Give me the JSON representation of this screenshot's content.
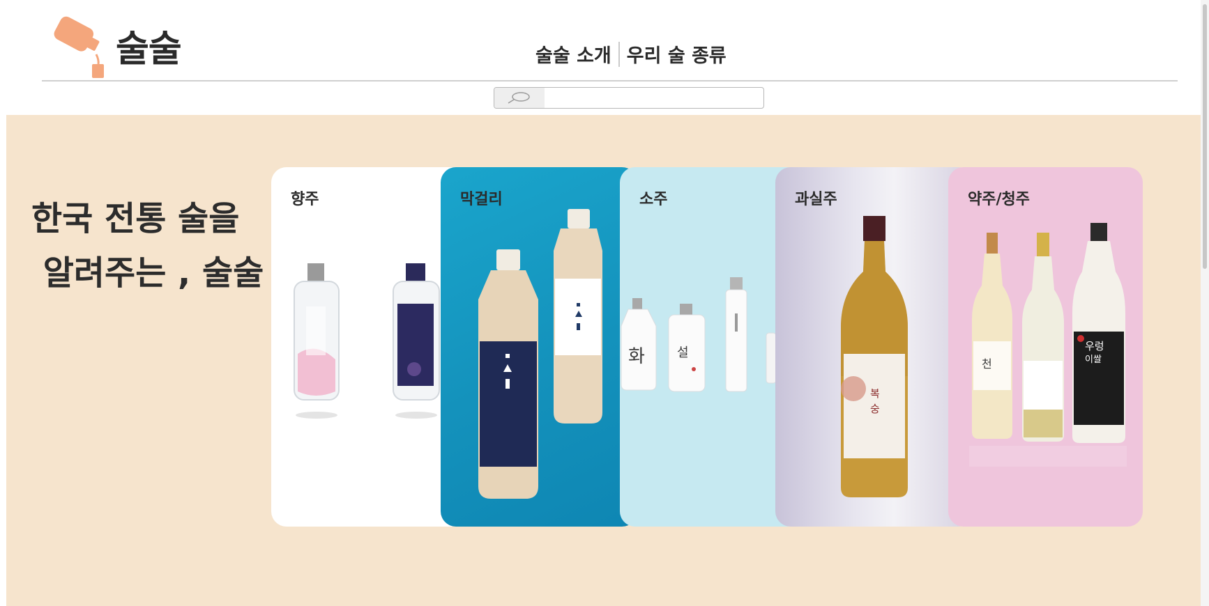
{
  "header": {
    "logo_text": "술술",
    "logo_icon": "pouring-bottle-icon",
    "nav": [
      {
        "label": "술술 소개"
      },
      {
        "label": "우리 술 종류"
      }
    ],
    "search": {
      "placeholder": "",
      "icon": "search-icon"
    }
  },
  "hero": {
    "headline": "한국 전통 술을\n 알려주는 , 술술"
  },
  "cards": [
    {
      "label": "향주"
    },
    {
      "label": "막걸리"
    },
    {
      "label": "소주"
    },
    {
      "label": "과실주"
    },
    {
      "label": "약주/청주"
    }
  ],
  "colors": {
    "hero_bg": "#f6e4cd",
    "logo_accent": "#f4a67c",
    "card_makgeolli": "#1aa5cc",
    "card_soju": "#c6e9f1",
    "card_yakju": "#efc5dc"
  }
}
